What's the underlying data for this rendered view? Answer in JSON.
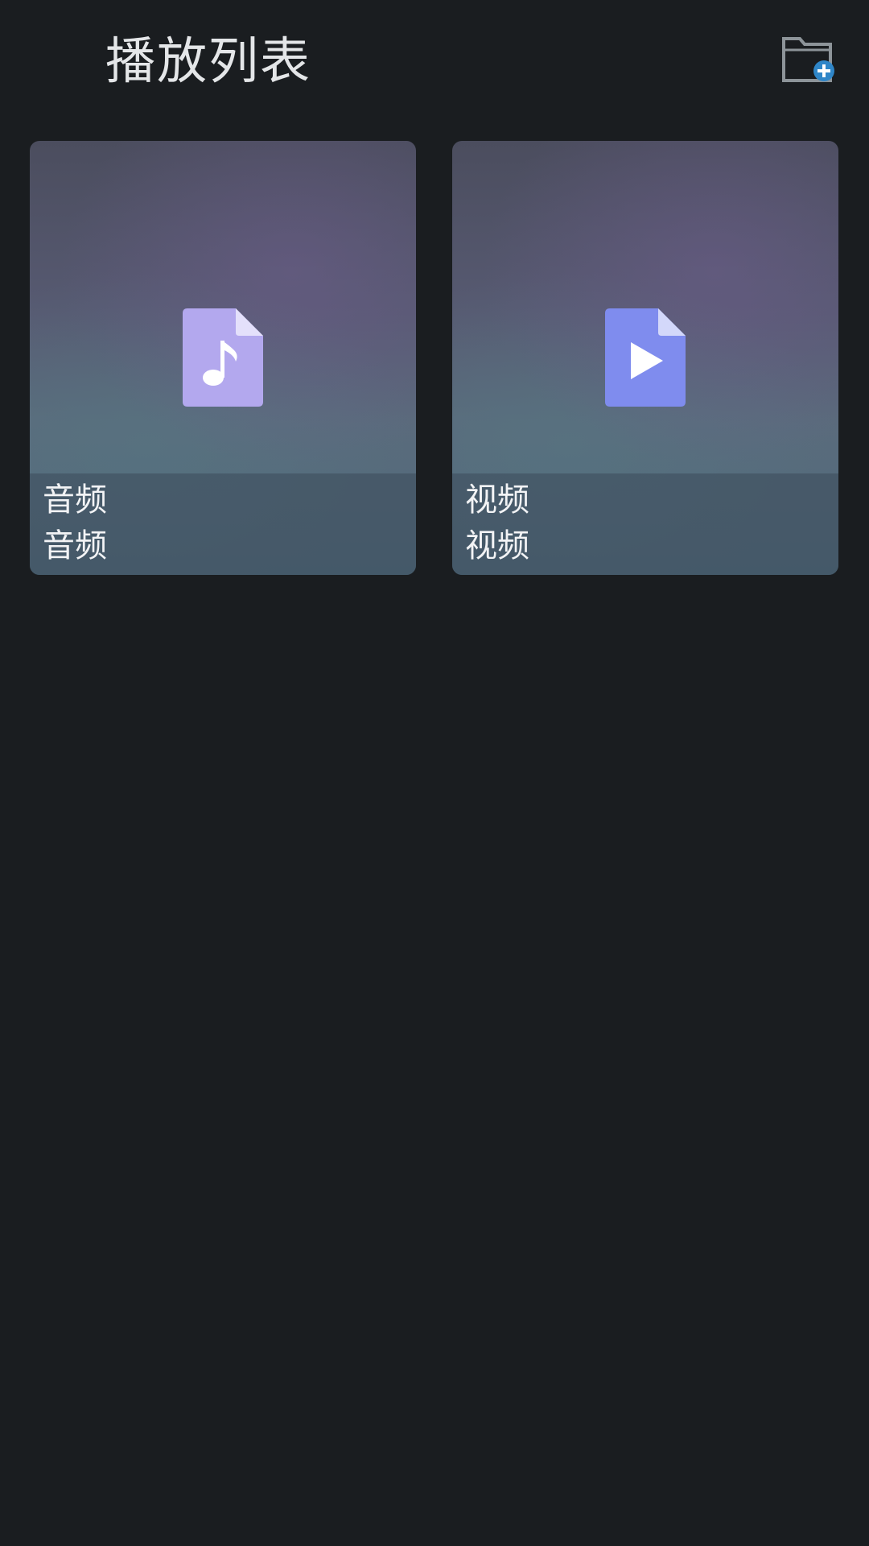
{
  "header": {
    "title": "播放列表",
    "add_folder_icon": "folder-add-icon"
  },
  "colors": {
    "background": "#1a1d20",
    "title_text": "#e4e6e8",
    "audio_icon": "#b3a8ee",
    "video_icon": "#7f8cee",
    "folder_outline": "#8d9499",
    "folder_add_badge": "#2f86c8"
  },
  "playlists": [
    {
      "name": "音频",
      "subtitle": "音频",
      "icon": "audio-file-icon"
    },
    {
      "name": "视频",
      "subtitle": "视频",
      "icon": "video-file-icon"
    }
  ]
}
